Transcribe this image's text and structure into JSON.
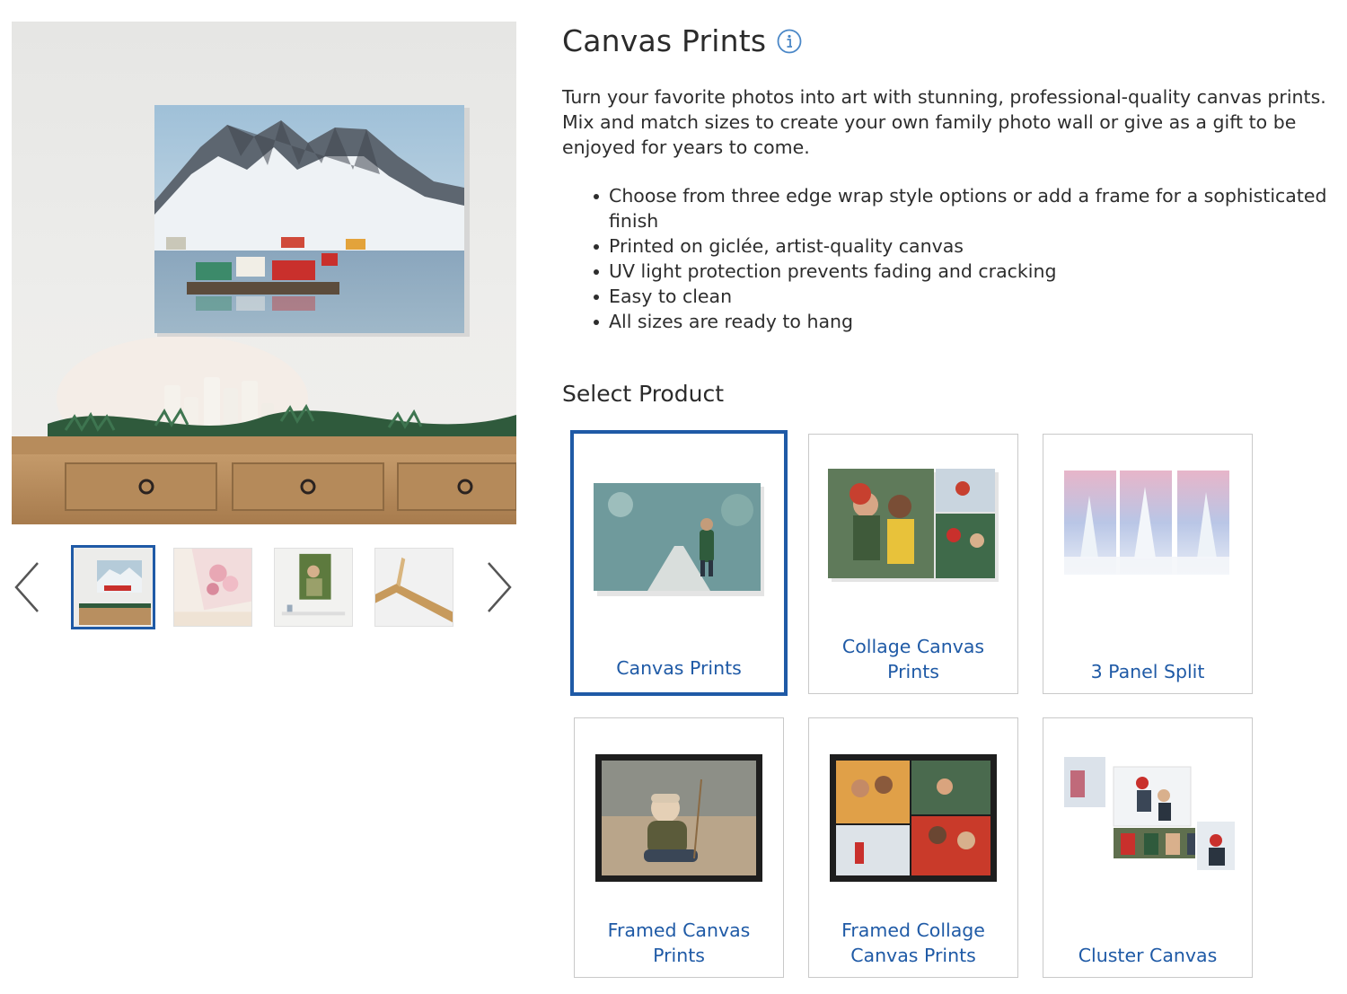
{
  "gallery": {
    "main_image_alt": "Canvas print of snowy mountain village hanging above a wooden console with candles and garland",
    "prev_label": "Previous",
    "next_label": "Next",
    "thumbnails": [
      {
        "name": "thumb-mountain-canvas",
        "selected": true
      },
      {
        "name": "thumb-blossom-canvas",
        "selected": false
      },
      {
        "name": "thumb-family-canvas",
        "selected": false
      },
      {
        "name": "thumb-canvas-edge",
        "selected": false
      }
    ]
  },
  "product": {
    "title": "Canvas Prints",
    "description": "Turn your favorite photos into art with stunning, professional-quality canvas prints. Mix and match sizes to create your own family photo wall or give as a gift to be enjoyed for years to come.",
    "features": [
      "Choose from three edge wrap style options or add a frame for a sophisticated finish",
      "Printed on giclée, artist-quality canvas",
      "UV light protection prevents fading and cracking",
      "Easy to clean",
      "All sizes are ready to hang"
    ]
  },
  "select_product": {
    "label": "Select Product",
    "options": [
      {
        "label": "Canvas Prints",
        "selected": true
      },
      {
        "label": "Collage Canvas Prints",
        "selected": false
      },
      {
        "label": "3 Panel Split",
        "selected": false
      },
      {
        "label": "Framed Canvas Prints",
        "selected": false
      },
      {
        "label": "Framed Collage Canvas Prints",
        "selected": false
      },
      {
        "label": "Cluster Canvas",
        "selected": false
      }
    ]
  },
  "colors": {
    "accent": "#1f5aa6",
    "text": "#2d2d2d",
    "card_border": "#c9c9c9"
  },
  "icons": {
    "info": "info-circle-icon",
    "prev": "chevron-left-icon",
    "next": "chevron-right-icon"
  }
}
